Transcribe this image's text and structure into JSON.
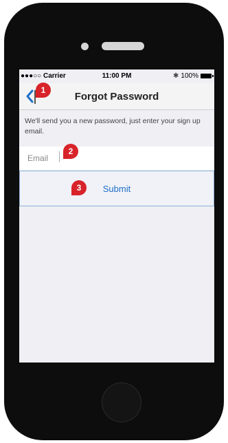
{
  "status_bar": {
    "carrier": "●●●○○ Carrier",
    "time": "11:00 PM",
    "battery": "100%",
    "bluetooth_icon": "bluetooth-icon"
  },
  "nav": {
    "title": "Forgot Password",
    "back_icon": "chevron-left-icon"
  },
  "content": {
    "info_text": "We'll send you a new password, just enter your sign up email.",
    "email_placeholder": "Email",
    "submit_label": "Submit"
  },
  "annotations": [
    "1",
    "2",
    "3"
  ],
  "colors": {
    "accent": "#1f6fc6",
    "badge": "#d8232a",
    "screen_bg": "#efeff4",
    "phone_body": "#0d0d0d"
  }
}
